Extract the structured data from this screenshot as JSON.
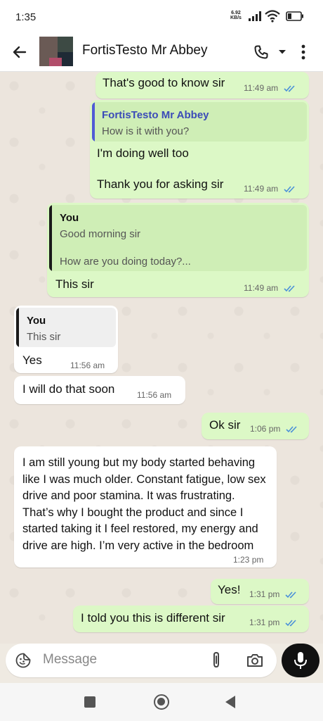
{
  "status_bar": {
    "time": "1:35",
    "net_speed_value": "6.92",
    "net_speed_unit": "KB/s"
  },
  "header": {
    "contact_name": "FortisTesto Mr Abbey"
  },
  "messages": [
    {
      "text": "That's good to know sir",
      "time": "11:49 am"
    },
    {
      "quote_name": "FortisTesto Mr Abbey",
      "quote_text": "How is it with you?",
      "line1": "I'm doing well too",
      "line2": "Thank you for asking sir",
      "time": "11:49 am"
    },
    {
      "quote_name": "You",
      "quote_line1": "Good morning sir",
      "quote_line2": "How are you doing today?...",
      "text": "This sir",
      "time": "11:49 am"
    },
    {
      "quote_name": "You",
      "quote_text": "This sir",
      "text": "Yes",
      "time": "11:56 am"
    },
    {
      "text": "I will do that soon",
      "time": "11:56 am"
    },
    {
      "text": "Ok sir",
      "time": "1:06 pm"
    },
    {
      "text": "I am still young but my body started behaving like I was much older. Constant fatigue, low sex drive and poor stamina. It was frustrating. That’s why I bought the product and since I started taking it I feel restored, my energy and drive are high. I’m very active in the bedroom",
      "time": "1:23 pm"
    },
    {
      "text": "Yes!",
      "time": "1:31 pm"
    },
    {
      "text": "I told you this is different sir",
      "time": "1:31 pm"
    }
  ],
  "composer": {
    "placeholder": "Message"
  },
  "icons": [
    "back-arrow-icon",
    "call-icon",
    "chevron-down-icon",
    "more-vert-icon",
    "sticker-icon",
    "attach-icon",
    "camera-icon",
    "mic-icon",
    "read-ticks-icon"
  ],
  "colors": {
    "outgoing_bubble": "#dcf8c6",
    "incoming_bubble": "#ffffff",
    "read_ticks": "#4a90d9",
    "quote_bar_dark": "#1a1a1a",
    "quote_bar_accent": "#4f5bd5"
  }
}
